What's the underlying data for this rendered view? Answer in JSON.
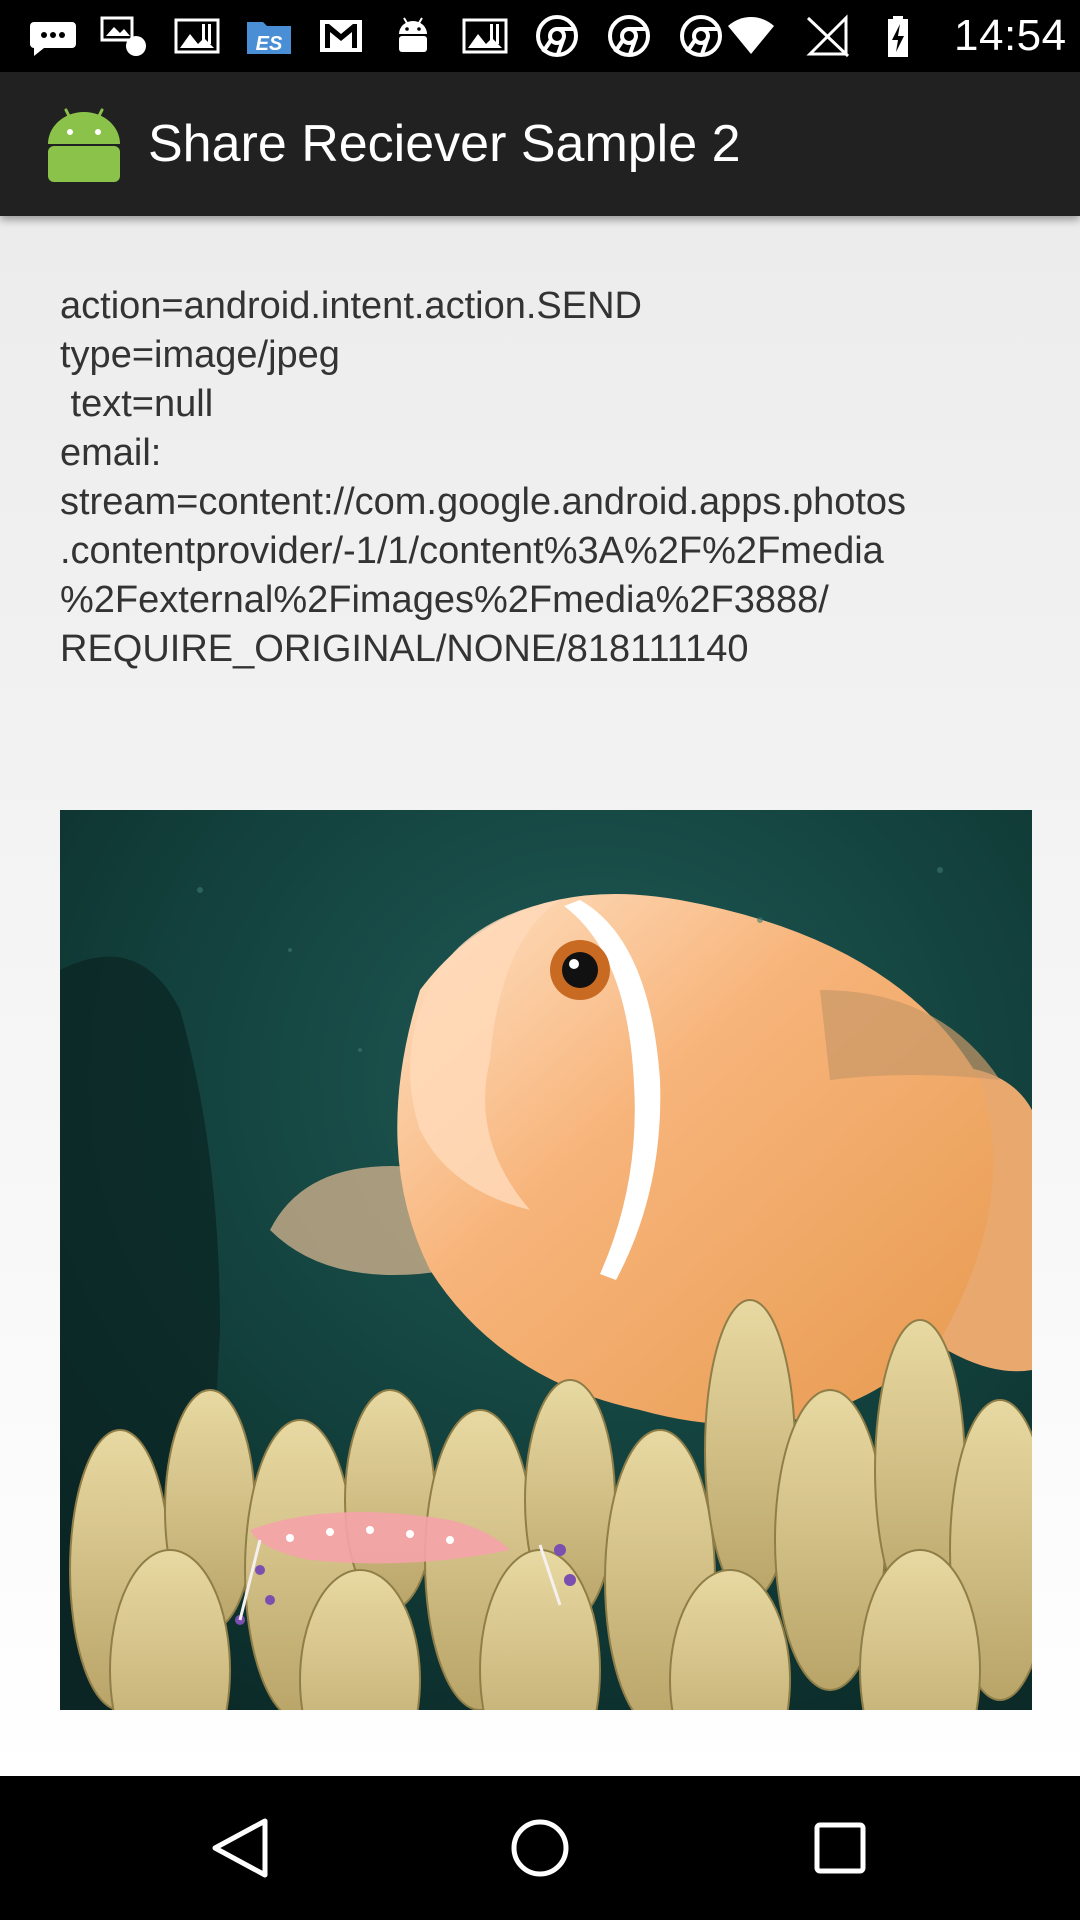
{
  "status_bar": {
    "time": "14:54",
    "notification_icons": [
      "chat-icon",
      "gallery-icon",
      "image-icon",
      "es-file-explorer-icon",
      "gmail-icon",
      "android-icon",
      "image-icon",
      "chrome-icon",
      "chrome-icon",
      "chrome-icon"
    ],
    "system_icons": [
      "wifi-icon",
      "no-sim-icon",
      "battery-charging-icon"
    ]
  },
  "action_bar": {
    "title": "Share Reciever Sample 2",
    "icon": "android-robot-icon"
  },
  "intent_info": {
    "lines": [
      "action=android.intent.action.SEND",
      "type=image/jpeg",
      " text=null",
      "email:",
      "stream=content://com.google.android.apps.photos",
      ".contentprovider/-1/1/content%3A%2F%2Fmedia",
      "%2Fexternal%2Fimages%2Fmedia%2F3888/",
      "REQUIRE_ORIGINAL/NONE/818111140"
    ]
  },
  "shared_image": {
    "subject": "clownfish-in-anemone"
  },
  "nav_bar": {
    "buttons": [
      "back",
      "home",
      "recents"
    ]
  },
  "colors": {
    "status_bar": "#000000",
    "action_bar": "#212121",
    "content_bg": "#f2f2f2",
    "text": "#333333",
    "android_green": "#8bc34a"
  }
}
